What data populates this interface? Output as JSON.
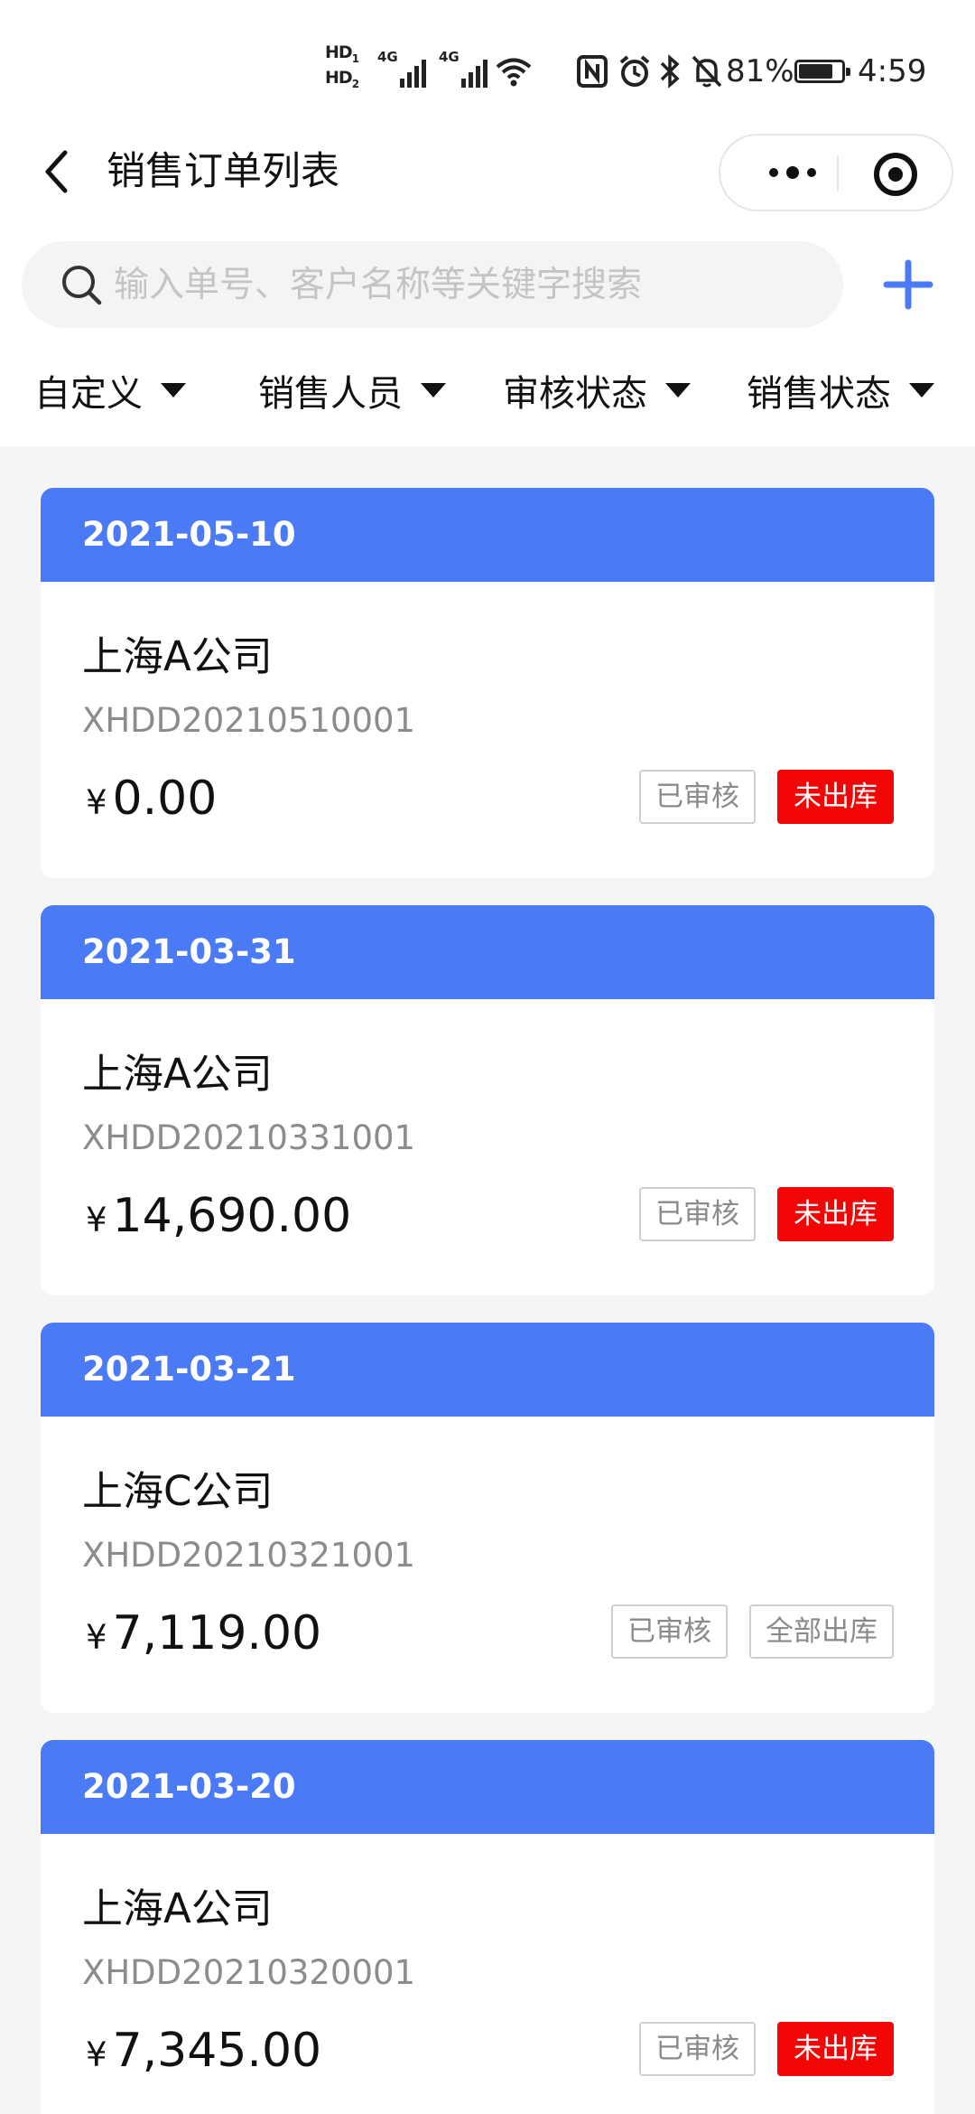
{
  "status_bar": {
    "hd1": "HD",
    "hd1_sub": "1",
    "hd2": "HD",
    "hd2_sub": "2",
    "net1": "4G",
    "net2": "4G",
    "battery_percent": "81%",
    "battery_level": 0.81,
    "time": "4:59",
    "icons": [
      "signal-icon",
      "wifi-icon",
      "nfc-icon",
      "alarm-icon",
      "bluetooth-icon",
      "mute-icon",
      "battery-icon"
    ]
  },
  "header": {
    "title": "销售订单列表",
    "back_icon": "chevron-left-icon",
    "capsule_icons": [
      "more-icon",
      "close-target-icon"
    ]
  },
  "search": {
    "placeholder": "输入单号、客户名称等关键字搜索",
    "value": "",
    "icon": "search-icon",
    "add_icon": "plus-icon"
  },
  "filters": [
    {
      "label": "自定义"
    },
    {
      "label": "销售人员"
    },
    {
      "label": "审核状态"
    },
    {
      "label": "销售状态"
    }
  ],
  "colors": {
    "accent": "#4a7af6",
    "danger": "#f10505"
  },
  "currency_symbol": "¥",
  "orders": [
    {
      "date": "2021-05-10",
      "customer": "上海A公司",
      "order_no": "XHDD20210510001",
      "amount": "0.00",
      "audit_status": "已审核",
      "stock_status": "未出库",
      "stock_highlight": true
    },
    {
      "date": "2021-03-31",
      "customer": "上海A公司",
      "order_no": "XHDD20210331001",
      "amount": "14,690.00",
      "audit_status": "已审核",
      "stock_status": "未出库",
      "stock_highlight": true
    },
    {
      "date": "2021-03-21",
      "customer": "上海C公司",
      "order_no": "XHDD20210321001",
      "amount": "7,119.00",
      "audit_status": "已审核",
      "stock_status": "全部出库",
      "stock_highlight": false
    },
    {
      "date": "2021-03-20",
      "customer": "上海A公司",
      "order_no": "XHDD20210320001",
      "amount": "7,345.00",
      "audit_status": "已审核",
      "stock_status": "未出库",
      "stock_highlight": true
    }
  ]
}
